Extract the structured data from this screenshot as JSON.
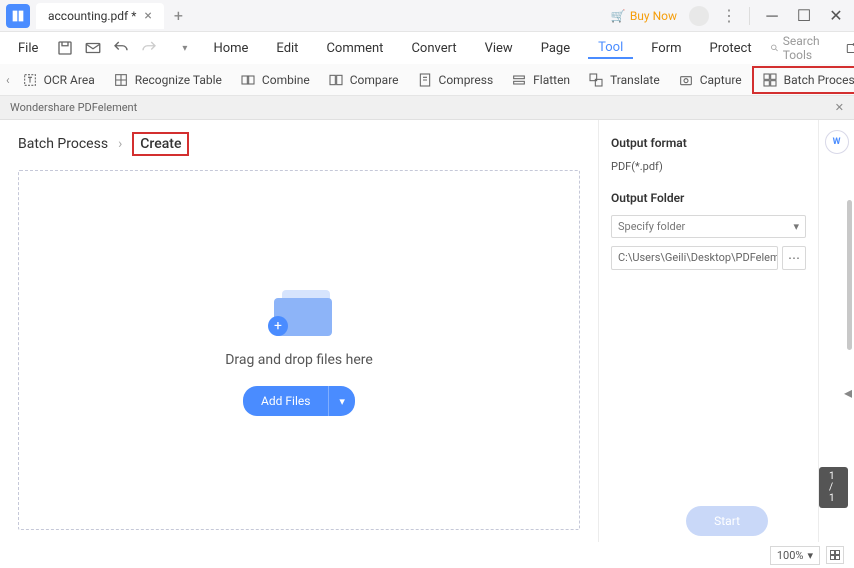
{
  "titlebar": {
    "tab_name": "accounting.pdf *",
    "buy_now": "Buy Now"
  },
  "menubar": {
    "file": "File",
    "items": [
      "Home",
      "Edit",
      "Comment",
      "Convert",
      "View",
      "Page",
      "Tool",
      "Form",
      "Protect"
    ],
    "active_index": 6,
    "search_placeholder": "Search Tools"
  },
  "toolbar": {
    "items": [
      "OCR Area",
      "Recognize Table",
      "Combine",
      "Compare",
      "Compress",
      "Flatten",
      "Translate",
      "Capture",
      "Batch Process"
    ]
  },
  "panel": {
    "title": "Wondershare PDFelement"
  },
  "breadcrumb": {
    "batch_process": "Batch Process",
    "create": "Create"
  },
  "dropzone": {
    "text": "Drag and drop files here",
    "add_files": "Add Files"
  },
  "sidebar": {
    "output_format_label": "Output format",
    "output_format_value": "PDF(*.pdf)",
    "output_folder_label": "Output Folder",
    "specify_folder": "Specify folder",
    "path": "C:\\Users\\Geili\\Desktop\\PDFelement\\Cr"
  },
  "rail": {
    "word": "W",
    "page_count": "1 / 1"
  },
  "footer": {
    "start": "Start",
    "zoom": "100%"
  }
}
